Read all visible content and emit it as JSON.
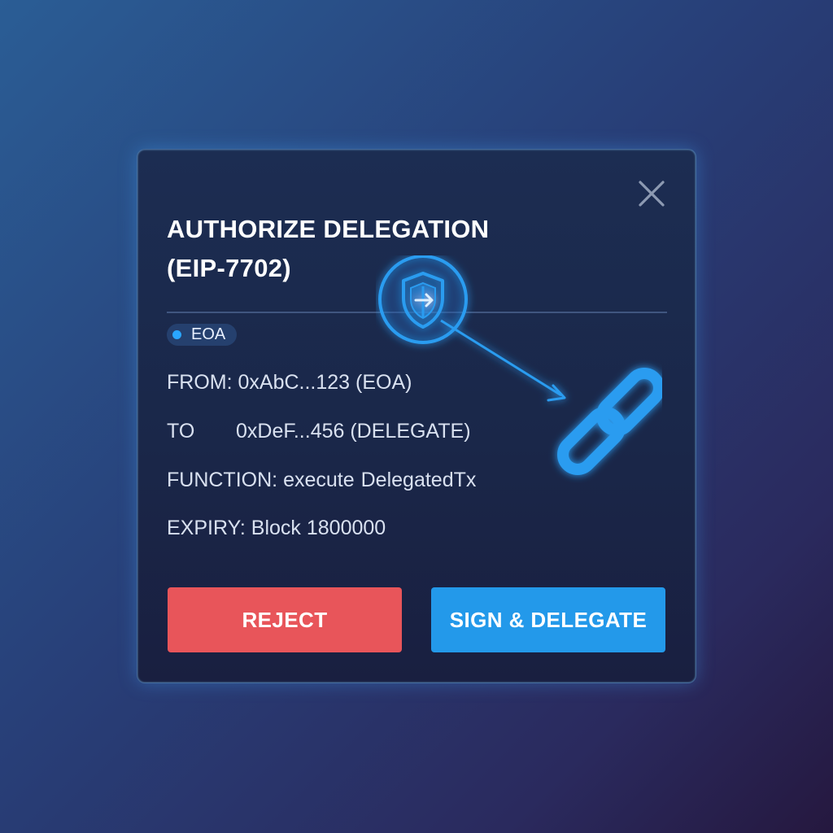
{
  "dialog": {
    "title_line1": "AUTHORIZE DELEGATION",
    "title_line2": "(EIP-7702)",
    "badge": "EOA",
    "from_label": "FROM:",
    "from_value": "0xAbC...123 (EOA)",
    "to_label": "TO",
    "to_value": "0xDeF...456 (DELEGATE)",
    "function_label": "FUNCTION:",
    "function_value_1": "execute",
    "function_value_2": "DelegatedTx",
    "expiry_label": "EXPIRY:",
    "expiry_value": "Block 1800000",
    "reject_label": "REJECT",
    "sign_label": "SIGN & DELEGATE"
  },
  "icons": {
    "close": "close-icon",
    "shield": "shield-icon",
    "link": "chain-link-icon",
    "arrow": "arrow-icon"
  },
  "colors": {
    "accent": "#2399ea",
    "reject": "#e8555a",
    "badge_dot": "#2aa6ff",
    "icon_blue": "#2b9cf0"
  }
}
